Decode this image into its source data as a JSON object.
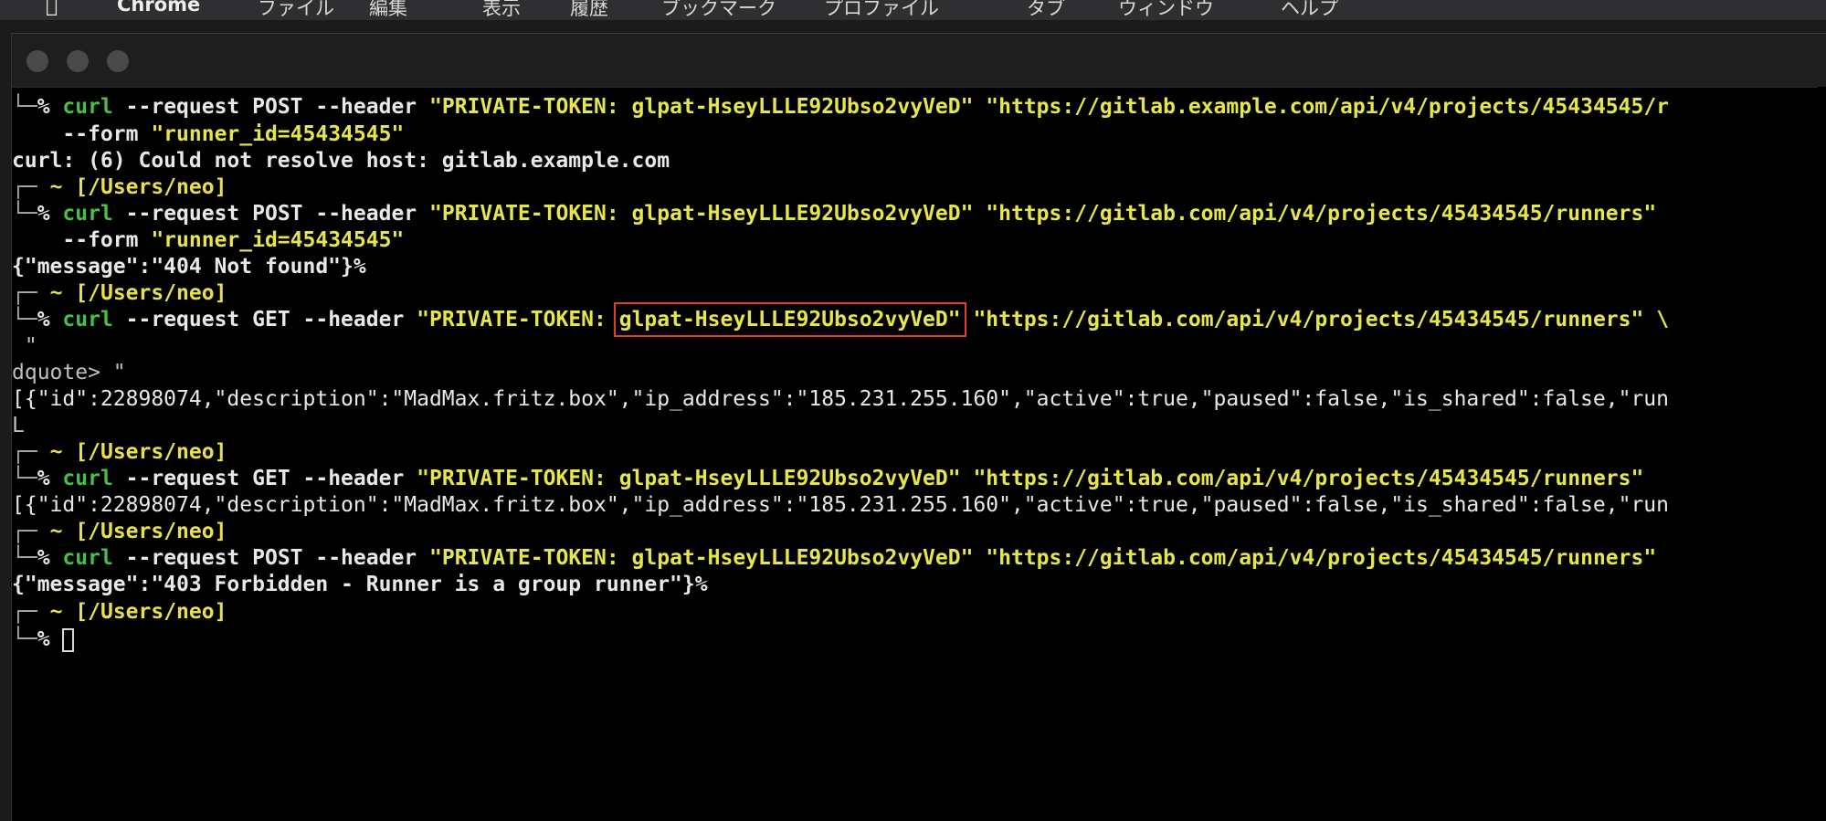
{
  "menubar": {
    "app": "Chrome",
    "items": [
      "ファイル",
      "編集",
      "表示",
      "履歴",
      "ブックマーク",
      "プロファイル",
      "タブ",
      "ウィンドウ",
      "ヘルプ"
    ]
  },
  "prompt": {
    "corner_top": "┌─",
    "corner_bottom": "└─",
    "symbol": "%",
    "tilde": "~",
    "path": "[/Users/neo]"
  },
  "lines": {
    "l1": {
      "cmd": "curl",
      "args": " --request POST --header ",
      "token_str": "\"PRIVATE-TOKEN: glpat-HseyLLLE92Ubso2vyVeD\"",
      "url_str": " \"https://gitlab.example.com/api/v4/projects/45434545/r"
    },
    "l2": {
      "args": "    --form ",
      "str": "\"runner_id=45434545\""
    },
    "l3": {
      "text": "curl: (6) Could not resolve host: gitlab.example.com"
    },
    "l5": {
      "cmd": "curl",
      "args": " --request POST --header ",
      "token_str": "\"PRIVATE-TOKEN: glpat-HseyLLLE92Ubso2vyVeD\"",
      "url_str": " \"https://gitlab.com/api/v4/projects/45434545/runners\" "
    },
    "l6": {
      "args": "    --form ",
      "str": "\"runner_id=45434545\""
    },
    "l7": {
      "text": "{\"message\":\"404 Not found\"}%"
    },
    "l9": {
      "cmd": "curl",
      "args": " --request GET --header ",
      "token_prefix": "\"PRIVATE-TOKEN: ",
      "token_hl": "glpat-HseyLLLE92Ubso2vyVeD\"",
      "url_str": " \"https://gitlab.com/api/v4/projects/45434545/runners\" \\"
    },
    "l10": {
      "text": " \""
    },
    "l11": {
      "text": "dquote> \""
    },
    "l12": {
      "text": "[{\"id\":22898074,\"description\":\"MadMax.fritz.box\",\"ip_address\":\"185.231.255.160\",\"active\":true,\"paused\":false,\"is_shared\":false,\"run"
    },
    "l13": {
      "text": "L"
    },
    "l15": {
      "cmd": "curl",
      "args": " --request GET --header ",
      "token_str": "\"PRIVATE-TOKEN: glpat-HseyLLLE92Ubso2vyVeD\"",
      "url_str": " \"https://gitlab.com/api/v4/projects/45434545/runners\""
    },
    "l16": {
      "text": "[{\"id\":22898074,\"description\":\"MadMax.fritz.box\",\"ip_address\":\"185.231.255.160\",\"active\":true,\"paused\":false,\"is_shared\":false,\"run"
    },
    "l18": {
      "cmd": "curl",
      "args": " --request POST --header ",
      "token_str": "\"PRIVATE-TOKEN: glpat-HseyLLLE92Ubso2vyVeD\"",
      "url_str": " \"https://gitlab.com/api/v4/projects/45434545/runners\""
    },
    "l19": {
      "text": "{\"message\":\"403 Forbidden - Runner is a group runner\"}%"
    }
  },
  "colors": {
    "command": "#46c046",
    "string": "#e6e64a",
    "highlight_box": "#e0401f",
    "background": "#000000"
  }
}
